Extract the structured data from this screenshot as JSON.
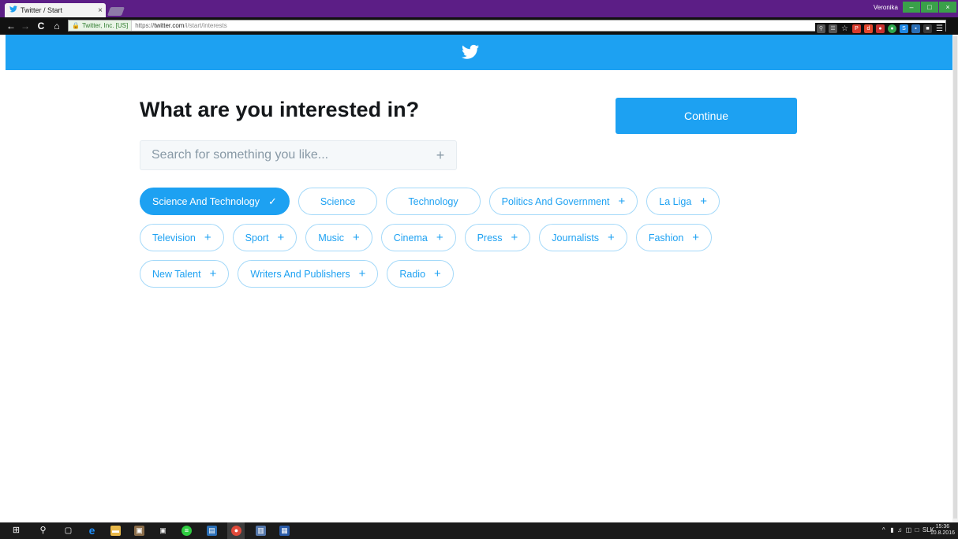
{
  "browser": {
    "tab_title": "Twitter / Start",
    "tab_close": "×",
    "window_user": "Veronika",
    "window_controls": {
      "minimize": "–",
      "maximize": "□",
      "close": "×"
    },
    "nav": {
      "back": "←",
      "forward": "→",
      "reload": "C",
      "home": "⌂"
    },
    "ssl_label": "Twitter, Inc. [US]",
    "url_scheme": "https://",
    "url_host": "twitter.com",
    "url_path": "/i/start/interests"
  },
  "brand": {
    "color": "#1da1f2"
  },
  "main": {
    "heading": "What are you interested in?",
    "continue_label": "Continue",
    "search": {
      "placeholder": "Search for something you like...",
      "add_symbol": "+"
    }
  },
  "chips": [
    {
      "label": "Science And Technology",
      "symbol": "✓",
      "selected": true
    },
    {
      "label": "Science",
      "symbol": ""
    },
    {
      "label": "Technology",
      "symbol": ""
    },
    {
      "label": "Politics And Government",
      "symbol": "+"
    },
    {
      "label": "La Liga",
      "symbol": "+"
    },
    {
      "label": "Television",
      "symbol": "+"
    },
    {
      "label": "Sport",
      "symbol": "+"
    },
    {
      "label": "Music",
      "symbol": "+"
    },
    {
      "label": "Cinema",
      "symbol": "+"
    },
    {
      "label": "Press",
      "symbol": "+"
    },
    {
      "label": "Journalists",
      "symbol": "+"
    },
    {
      "label": "Fashion",
      "symbol": "+"
    },
    {
      "label": "New Talent",
      "symbol": "+"
    },
    {
      "label": "Writers And Publishers",
      "symbol": "+"
    },
    {
      "label": "Radio",
      "symbol": "+"
    }
  ],
  "taskbar": {
    "language": "SLK",
    "time": "15:36",
    "date": "10.8.2016"
  }
}
